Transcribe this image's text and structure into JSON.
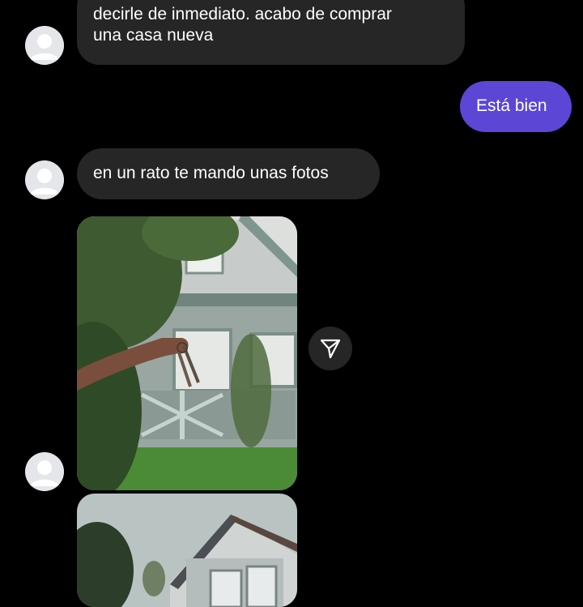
{
  "messages": [
    {
      "direction": "incoming",
      "lines": [
        "decirle de inmediato.  acabo de comprar",
        "una casa nueva"
      ]
    },
    {
      "direction": "outgoing",
      "text": "Está bien"
    },
    {
      "direction": "incoming",
      "text": "en un rato te mando unas fotos"
    }
  ],
  "photos": [
    {
      "subject": "hand-holding-house-keys-in-front-of-house"
    },
    {
      "subject": "house-exterior-with-gable-roof"
    }
  ],
  "icons": {
    "avatar": "avatar-placeholder-icon",
    "share": "send-paper-plane-icon"
  },
  "colors": {
    "background": "#000000",
    "incoming_bubble": "#262626",
    "outgoing_bubble": "#5b46d6",
    "text": "#ffffff"
  }
}
